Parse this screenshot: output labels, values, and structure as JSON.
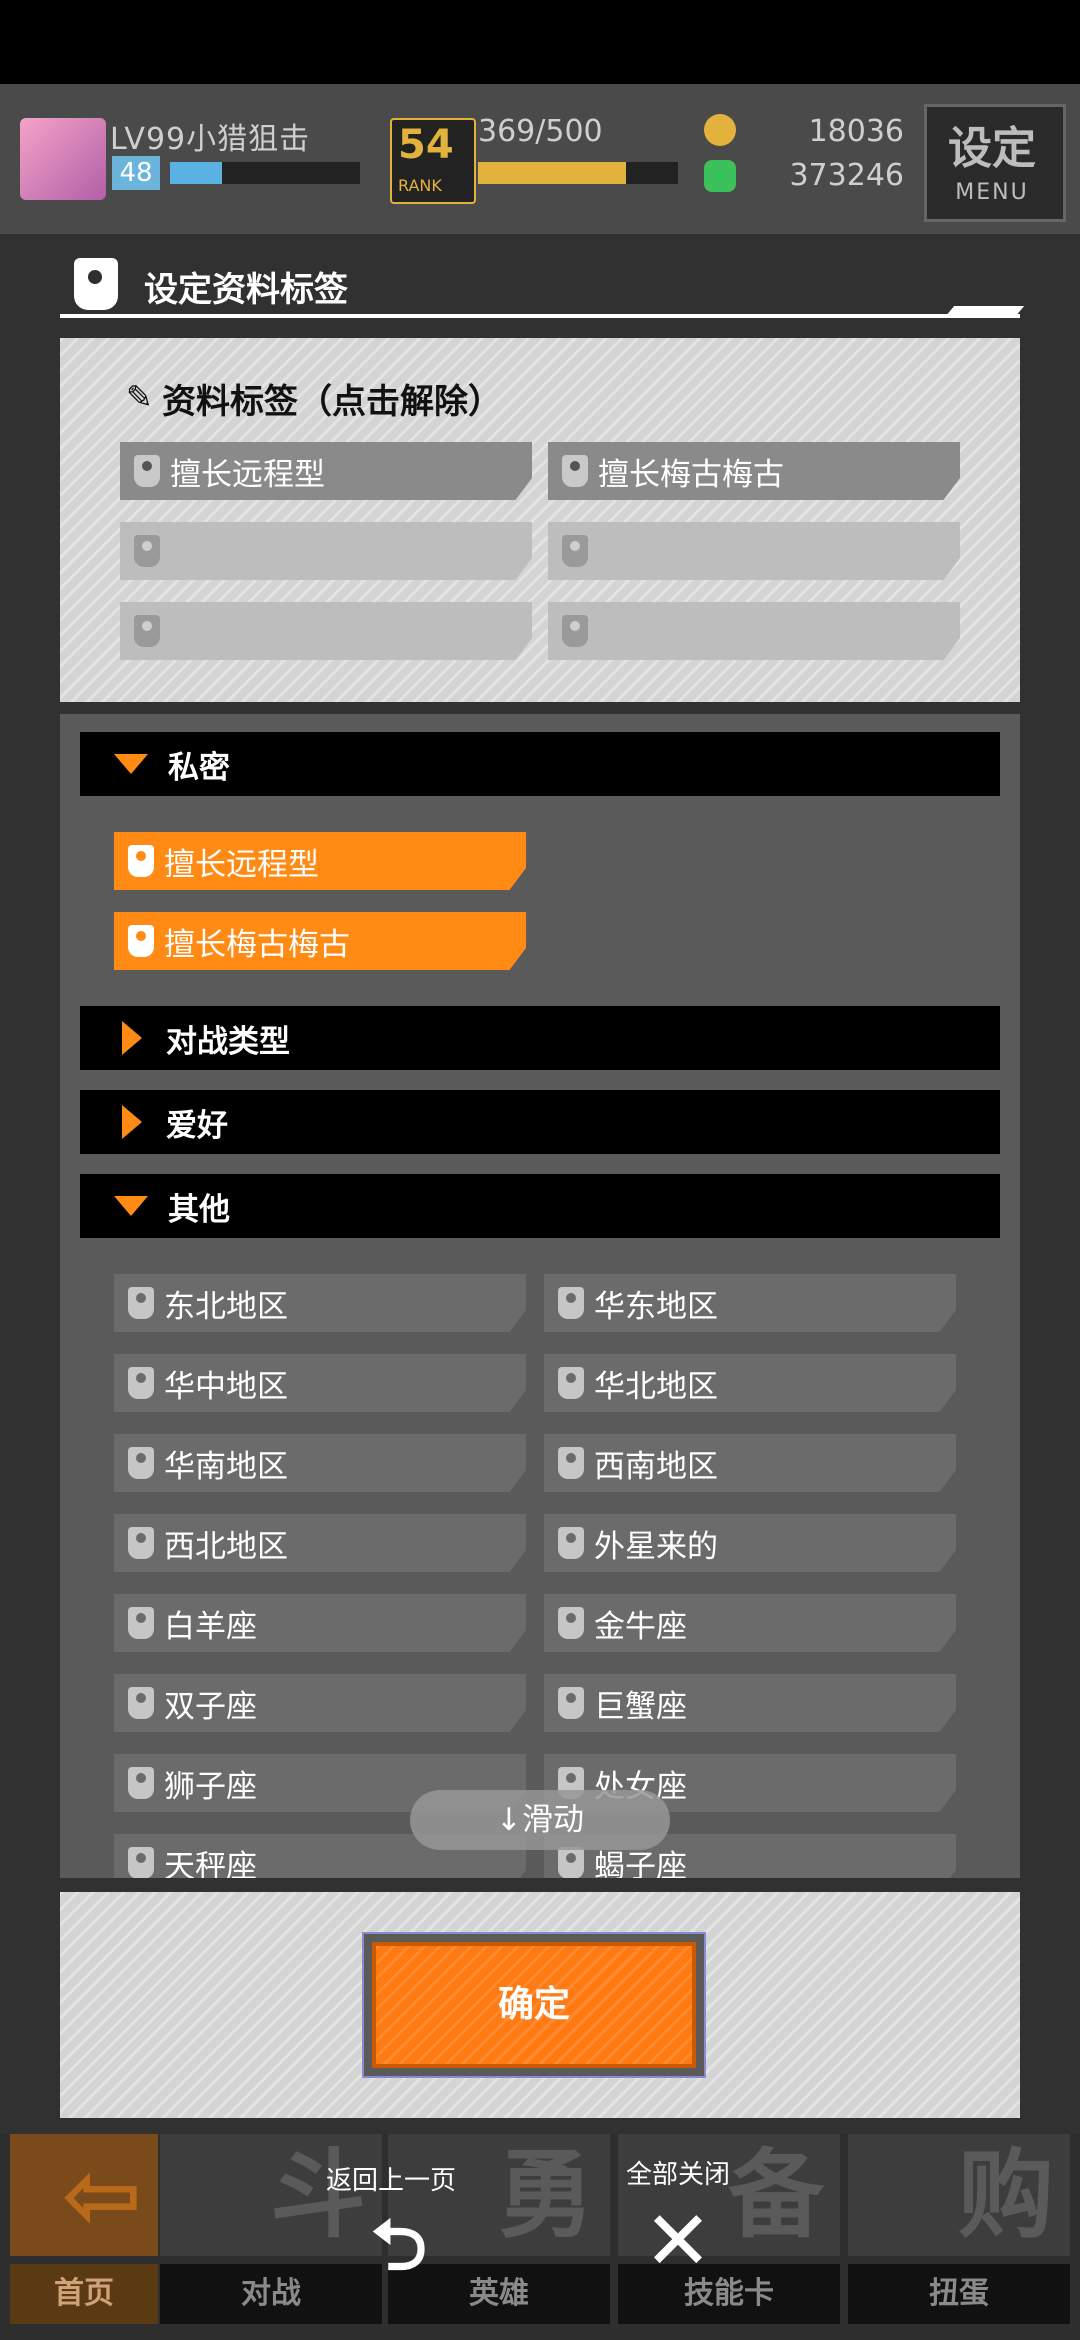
{
  "hud": {
    "player_name": "LV99小猎狙击",
    "level": "48",
    "rank_number": "54",
    "rank_label": "RANK",
    "stamina": "369/500",
    "gold": "18036",
    "gems": "373246",
    "menu_title": "设定",
    "menu_label": "MENU"
  },
  "panel": {
    "title": "设定资料标签",
    "selected_header": "资料标签（点击解除）",
    "selected_tags": [
      "擅长远程型",
      "擅长梅古梅古",
      "",
      "",
      "",
      ""
    ]
  },
  "categories": {
    "private": {
      "label": "私密",
      "tags": [
        "擅长远程型",
        "擅长梅古梅古"
      ]
    },
    "battle_type": {
      "label": "对战类型"
    },
    "hobby": {
      "label": "爱好"
    },
    "other": {
      "label": "其他",
      "tags": [
        "东北地区",
        "华东地区",
        "华中地区",
        "华北地区",
        "华南地区",
        "西南地区",
        "西北地区",
        "外星来的",
        "白羊座",
        "金牛座",
        "双子座",
        "巨蟹座",
        "狮子座",
        "处女座",
        "天秤座",
        "蝎子座"
      ]
    }
  },
  "scroll_hint": "↓滑动",
  "confirm_label": "确定",
  "overlay": {
    "back_label": "返回上一页",
    "close_all_label": "全部关闭",
    "back_icon": "return-arrow-icon",
    "close_icon": "close-x-icon"
  },
  "bottom_nav": [
    {
      "label": "首页",
      "art": "⇦"
    },
    {
      "label": "对战",
      "art": "斗"
    },
    {
      "label": "英雄",
      "art": "勇"
    },
    {
      "label": "技能卡",
      "art": "备"
    },
    {
      "label": "扭蛋",
      "art": "购"
    }
  ],
  "colors": {
    "accent": "#ff8a14",
    "panel_bg": "#d4d4d4",
    "category_bg": "#000000"
  }
}
